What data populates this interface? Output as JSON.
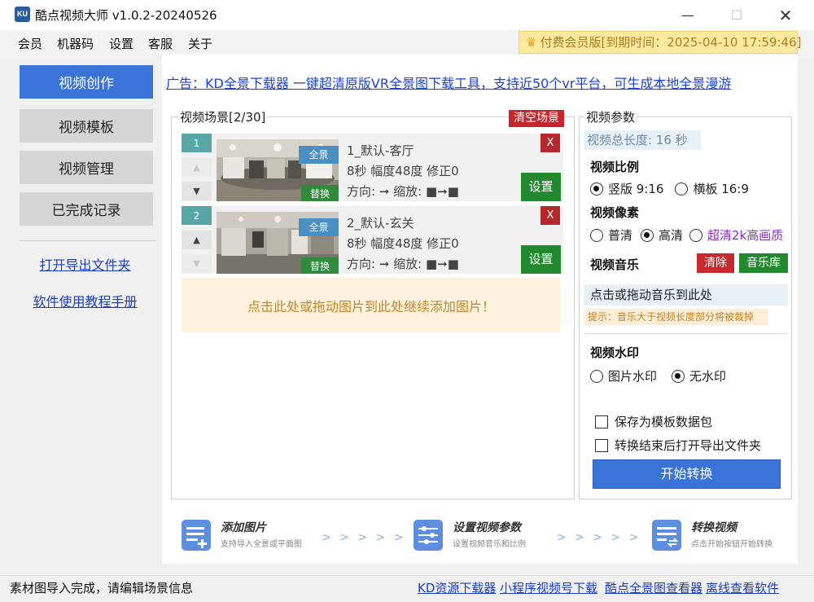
{
  "window": {
    "icon_text": "KU",
    "title": "酷点视频大师 v1.0.2-20240526",
    "minimize": "—",
    "maximize": "☐",
    "close": "✕"
  },
  "menu": [
    "会员",
    "机器码",
    "设置",
    "客服",
    "关于"
  ],
  "vip_badge": "付费会员版[到期时间：2025-04-10 17:59:46]",
  "sidebar": {
    "buttons": [
      "视频创作",
      "视频模板",
      "视频管理",
      "已完成记录"
    ],
    "active_index": 0,
    "links": [
      "打开导出文件夹",
      "软件使用教程手册"
    ]
  },
  "ad_text": "广告：KD全景下载器 一键超清原版VR全景图下载工具，支持近50个vr平台，可生成本地全景漫游",
  "scenes_panel": {
    "title": "视频场景[2/30]",
    "clear_label": "清空场景",
    "add_hint": "点击此处或拖动图片到此处继续添加图片！",
    "scenes": [
      {
        "index": "1",
        "name": "1_默认-客厅",
        "meta": "8秒 幅度48度 修正0",
        "dir": "方向: ➞ 缩放: ■➞■",
        "tag_pano": "全景",
        "tag_replace": "替换",
        "delete": "X",
        "settings": "设置",
        "up": "▲",
        "down": "▼"
      },
      {
        "index": "2",
        "name": "2_默认-玄关",
        "meta": "8秒 幅度48度 修正0",
        "dir": "方向: ➞ 缩放: ■➞■",
        "tag_pano": "全景",
        "tag_replace": "替换",
        "delete": "X",
        "settings": "设置",
        "up": "▲",
        "down": "▼"
      }
    ]
  },
  "params": {
    "title": "视频参数",
    "total_length": "视频总长度: 16 秒",
    "ratio_label": "视频比例",
    "ratio_options": [
      "竖版 9:16",
      "横板 16:9"
    ],
    "ratio_selected": 0,
    "pixel_label": "视频像素",
    "pixel_options": [
      "普清",
      "高清",
      "超清2k高画质"
    ],
    "pixel_selected": 1,
    "music_label": "视频音乐",
    "music_clear": "清除",
    "music_library": "音乐库",
    "music_drop": "点击或拖动音乐到此处",
    "music_tip": "提示：音乐大于视频长度部分将被裁掉",
    "watermark_label": "视频水印",
    "watermark_options": [
      "图片水印",
      "无水印"
    ],
    "watermark_selected": 1,
    "checkbox_save": "保存为模板数据包",
    "checkbox_open": "转换结束后打开导出文件夹",
    "start_button": "开始转换"
  },
  "steps": [
    {
      "title": "添加图片",
      "sub": "支持导入全景或平面图",
      "icon": "image-add-icon"
    },
    {
      "title": "设置视频参数",
      "sub": "设置视频音乐和比例",
      "icon": "settings-sliders-icon"
    },
    {
      "title": "转换视频",
      "sub": "点击开始按钮开始转换",
      "icon": "convert-icon"
    }
  ],
  "chevrons": "> > > > >",
  "status": {
    "text": "素材图导入完成，请编辑场景信息",
    "links": [
      "KD资源下载器",
      "小程序视频号下载",
      "酷点全景图查看器",
      "离线查看软件"
    ]
  }
}
